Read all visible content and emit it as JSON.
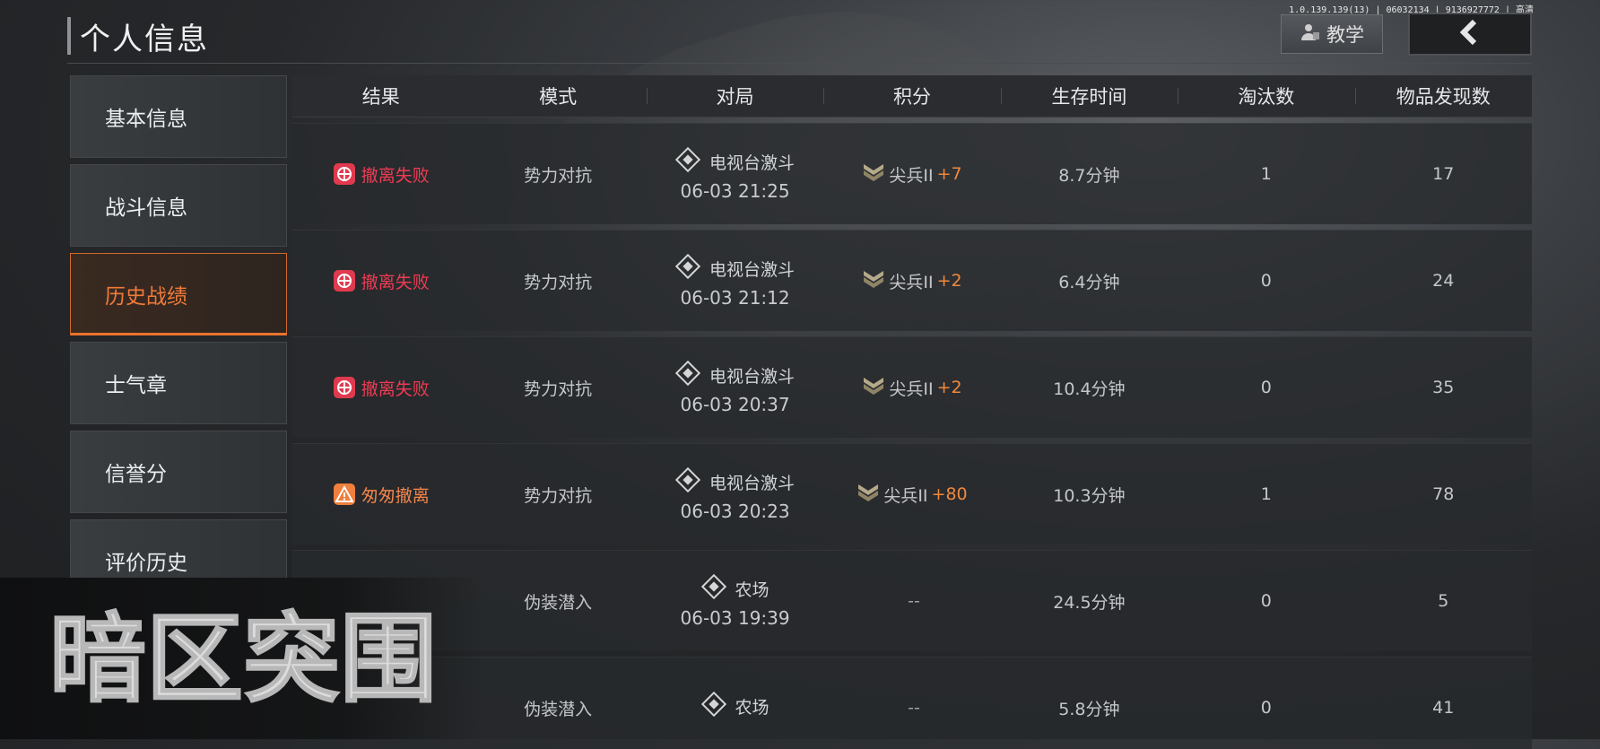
{
  "header": {
    "title": "个人信息",
    "version_text": "1.0.139.139(13) | 06032134 | 9136927772 | 高清",
    "tutorial_label": "教学"
  },
  "sidebar": {
    "items": [
      {
        "label": "基本信息",
        "active": false
      },
      {
        "label": "战斗信息",
        "active": false
      },
      {
        "label": "历史战绩",
        "active": true
      },
      {
        "label": "士气章",
        "active": false
      },
      {
        "label": "信誉分",
        "active": false
      },
      {
        "label": "评价历史",
        "active": false
      }
    ]
  },
  "table": {
    "columns": [
      "结果",
      "模式",
      "对局",
      "积分",
      "生存时间",
      "淘汰数",
      "物品发现数"
    ],
    "rows": [
      {
        "result": "撤离失败",
        "result_type": "fail",
        "mode": "势力对抗",
        "map": "电视台激斗",
        "time": "06-03 21:25",
        "rank": "尖兵II",
        "points": "+7",
        "survival": "8.7分钟",
        "kills": "1",
        "items": "17"
      },
      {
        "result": "撤离失败",
        "result_type": "fail",
        "mode": "势力对抗",
        "map": "电视台激斗",
        "time": "06-03 21:12",
        "rank": "尖兵II",
        "points": "+2",
        "survival": "6.4分钟",
        "kills": "0",
        "items": "24"
      },
      {
        "result": "撤离失败",
        "result_type": "fail",
        "mode": "势力对抗",
        "map": "电视台激斗",
        "time": "06-03 20:37",
        "rank": "尖兵II",
        "points": "+2",
        "survival": "10.4分钟",
        "kills": "0",
        "items": "35"
      },
      {
        "result": "匆匆撤离",
        "result_type": "hurried",
        "mode": "势力对抗",
        "map": "电视台激斗",
        "time": "06-03 20:23",
        "rank": "尖兵II",
        "points": "+80",
        "survival": "10.3分钟",
        "kills": "1",
        "items": "78"
      },
      {
        "result": "",
        "result_type": "hidden",
        "mode": "伪装潜入",
        "map": "农场",
        "time": "06-03 19:39",
        "rank": "",
        "points": "--",
        "survival": "24.5分钟",
        "kills": "0",
        "items": "5"
      },
      {
        "result": "",
        "result_type": "hidden",
        "mode": "伪装潜入",
        "map": "农场",
        "time": "",
        "rank": "",
        "points": "--",
        "survival": "5.8分钟",
        "kills": "0",
        "items": "41"
      }
    ]
  },
  "logo": {
    "text": "暗区突围"
  },
  "colors": {
    "accent_orange": "#e8742f",
    "fail_red": "#ee3b53",
    "hurried_orange": "#f3864a"
  }
}
